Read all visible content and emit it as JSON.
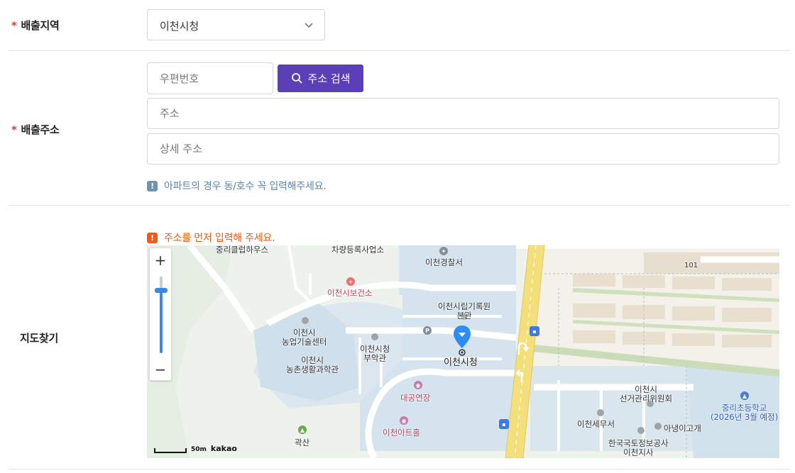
{
  "region": {
    "label": "배출지역",
    "required_mark": "*",
    "selected": "이천시청"
  },
  "address": {
    "label": "배출주소",
    "required_mark": "*",
    "zipcode_placeholder": "우편번호",
    "search_button": "주소 검색",
    "address_placeholder": "주소",
    "detail_placeholder": "상세 주소",
    "notice": "아파트의 경우 동/호수 꼭 입력해주세요."
  },
  "map_section": {
    "label": "지도찾기",
    "warning": "주소를 먼저 입력해 주세요."
  },
  "map": {
    "labels": {
      "club": "중리클럽하우스",
      "vehicle": "차량등록사업소",
      "police": "이천경찰서",
      "health": "이천시보건소",
      "records": "이천시립기록원\n본관",
      "agri_center": "이천시\n농업기술센터",
      "annex": "이천시청\n부악관",
      "rural_hall": "이천시\n농촌생활과학관",
      "cityhall": "이천시청",
      "theater": "대공연장",
      "arthall": "이천아트홀",
      "mountain": "곽산",
      "election": "이천시\n선거관리위원회",
      "tax": "이천세무서",
      "anyang": "아냉이고개",
      "nia": "한국국토정보공사\n이천지사",
      "school": "중리초등학교\n(2026년 3월 예정)",
      "road_no": "101"
    },
    "zoom_in": "+",
    "zoom_out": "−",
    "scale": "50m",
    "brand": "kakao"
  },
  "colors": {
    "accent": "#5a3fb8",
    "required": "#e53935",
    "warning": "#e8590c",
    "info": "#5b86a8"
  }
}
